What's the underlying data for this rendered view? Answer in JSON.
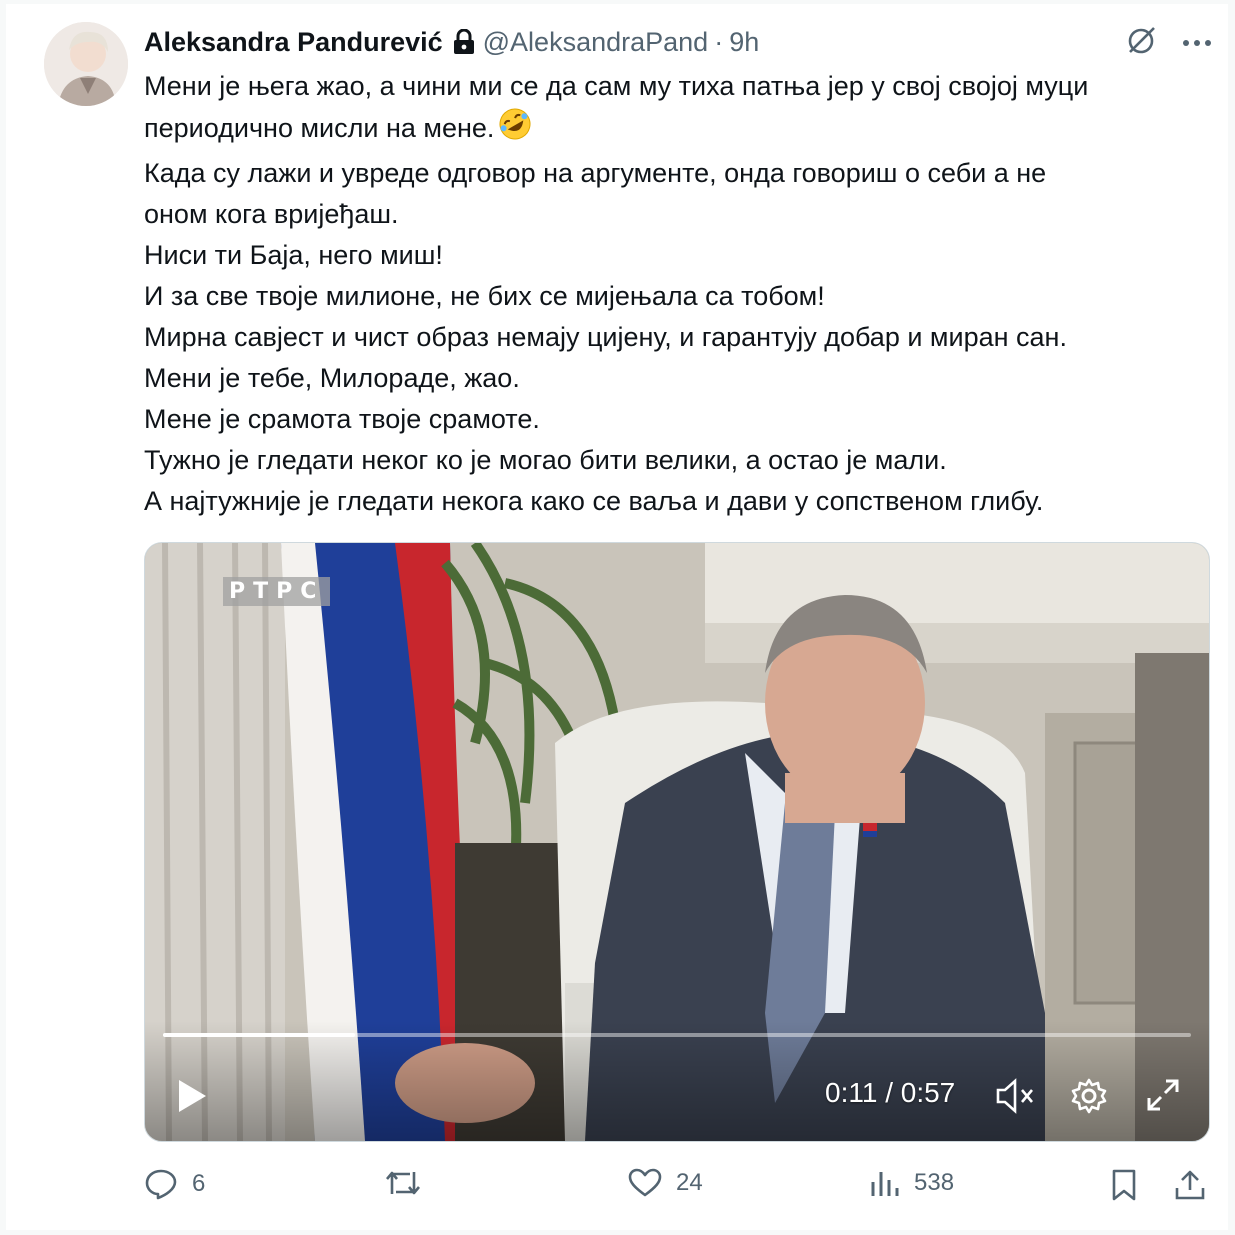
{
  "tweet": {
    "author_name": "Aleksandra Pandurević",
    "handle": "@AleksandraPand",
    "separator": "·",
    "time": "9h",
    "lines": [
      "Мени је њега жао, а чини ми се да сам му тиха патња јер у свој својој муци",
      "периодично мисли на мене.",
      "Када су лажи и увреде одговор на аргументе, онда говориш о себи а не",
      "оном кога вријеђаш.",
      "Ниси ти Баја, него миш!",
      "И за све твоје милионе, не бих се мијењала са тобом!",
      "Мирна савјест и чист образ немају цијену, и гарантују добар и миран сан.",
      "Мени је тебе, Милораде, жао.",
      "Мене је срамота твоје срамоте.",
      "Тужно је гледати неког ко је могао бити велики, а остао је мали.",
      "А најтужније је гледати некога како се ваља и дави у сопственом глибу."
    ],
    "emoji_icon": "rolling-on-the-floor-laughing-emoji"
  },
  "video": {
    "channel_logo": "РТРС",
    "timecode": "0:11 / 0:57",
    "progress_fraction": 0.187
  },
  "actions": {
    "replies": "6",
    "reposts": "",
    "likes": "24",
    "views": "538"
  },
  "colors": {
    "muted_text": "#536471",
    "flag_red": "#c8262d",
    "flag_blue": "#1f3f99"
  }
}
